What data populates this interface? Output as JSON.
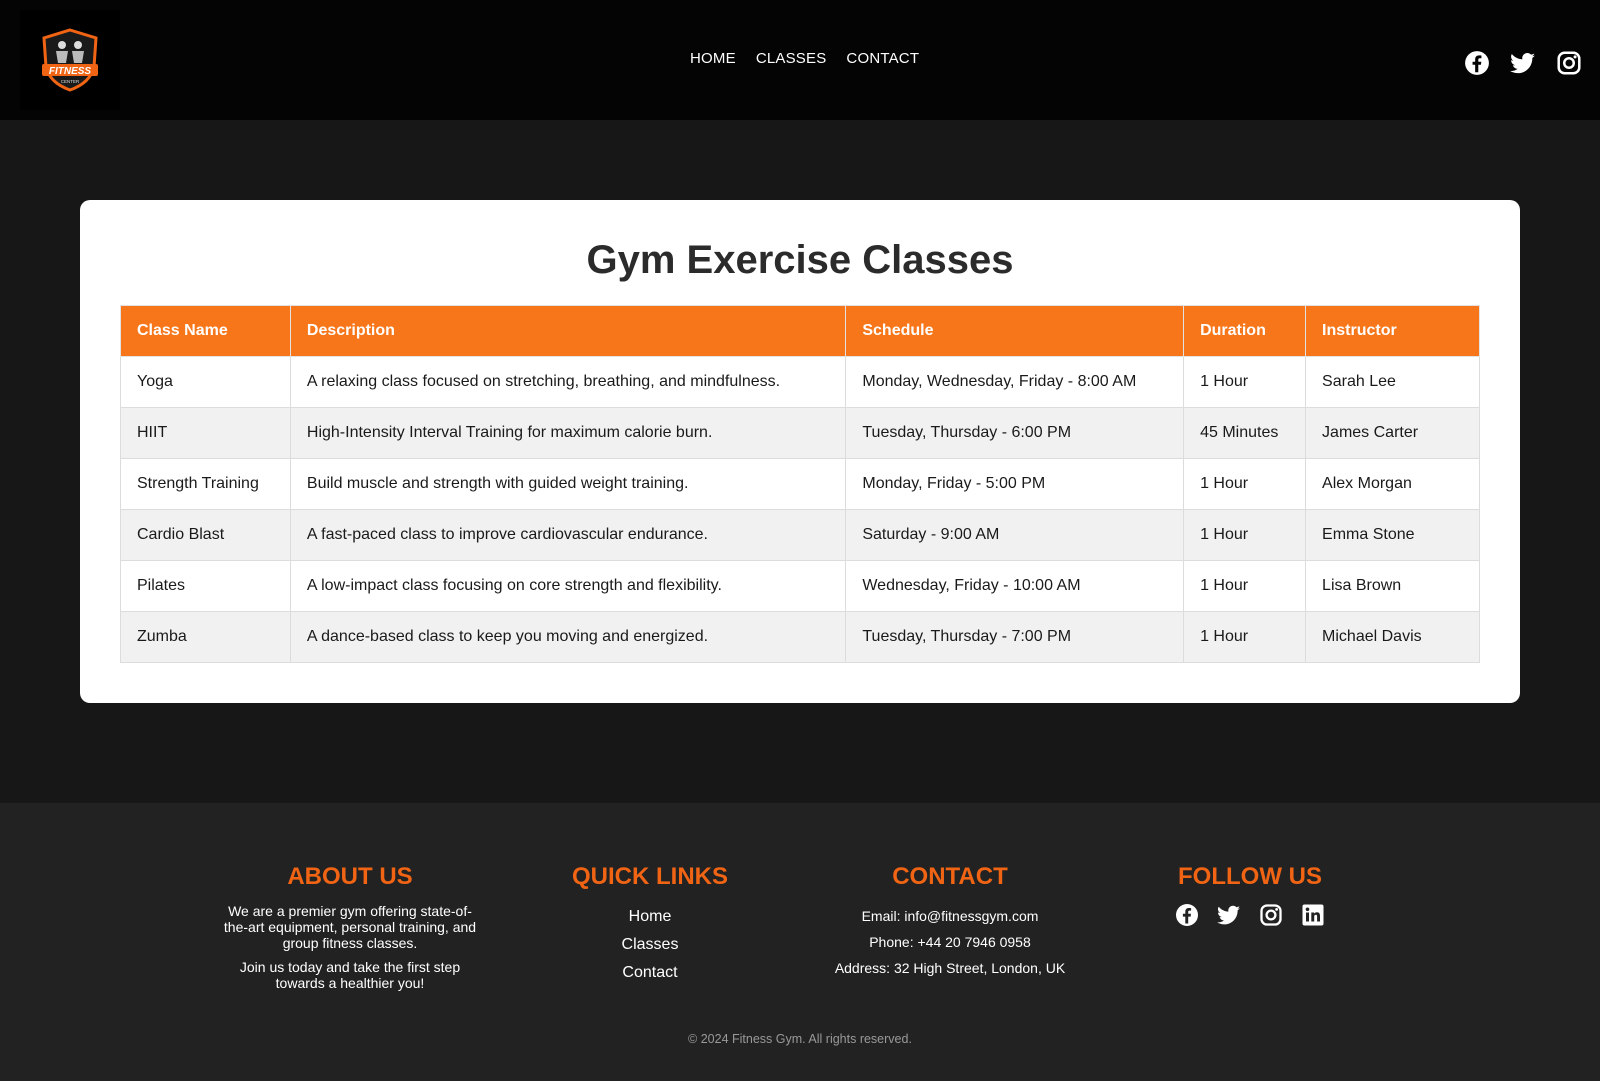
{
  "header": {
    "logo": {
      "text_main": "FITNESS",
      "text_sub": "CENTER"
    },
    "nav": [
      {
        "label": "HOME"
      },
      {
        "label": "CLASSES"
      },
      {
        "label": "CONTACT"
      }
    ],
    "social": [
      "facebook-icon",
      "twitter-icon",
      "instagram-icon"
    ]
  },
  "main": {
    "title": "Gym Exercise Classes",
    "table": {
      "headers": [
        "Class Name",
        "Description",
        "Schedule",
        "Duration",
        "Instructor"
      ],
      "rows": [
        [
          "Yoga",
          "A relaxing class focused on stretching, breathing, and mindfulness.",
          "Monday, Wednesday, Friday - 8:00 AM",
          "1 Hour",
          "Sarah Lee"
        ],
        [
          "HIIT",
          "High-Intensity Interval Training for maximum calorie burn.",
          "Tuesday, Thursday - 6:00 PM",
          "45 Minutes",
          "James Carter"
        ],
        [
          "Strength Training",
          "Build muscle and strength with guided weight training.",
          "Monday, Friday - 5:00 PM",
          "1 Hour",
          "Alex Morgan"
        ],
        [
          "Cardio Blast",
          "A fast-paced class to improve cardiovascular endurance.",
          "Saturday - 9:00 AM",
          "1 Hour",
          "Emma Stone"
        ],
        [
          "Pilates",
          "A low-impact class focusing on core strength and flexibility.",
          "Wednesday, Friday - 10:00 AM",
          "1 Hour",
          "Lisa Brown"
        ],
        [
          "Zumba",
          "A dance-based class to keep you moving and energized.",
          "Tuesday, Thursday - 7:00 PM",
          "1 Hour",
          "Michael Davis"
        ]
      ]
    }
  },
  "footer": {
    "about": {
      "title": "ABOUT US",
      "p1": "We are a premier gym offering state-of-the-art equipment, personal training, and group fitness classes.",
      "p2": "Join us today and take the first step towards a healthier you!"
    },
    "quick_links": {
      "title": "QUICK LINKS",
      "items": [
        {
          "label": "Home"
        },
        {
          "label": "Classes"
        },
        {
          "label": "Contact"
        }
      ]
    },
    "contact": {
      "title": "CONTACT",
      "email": "Email: info@fitnessgym.com",
      "phone": "Phone: +44 20 7946 0958",
      "address": "Address: 32 High Street, London, UK"
    },
    "follow": {
      "title": "FOLLOW US",
      "icons": [
        "facebook-icon",
        "twitter-icon",
        "instagram-icon",
        "linkedin-icon"
      ]
    },
    "copyright": "© 2024 Fitness Gym. All rights reserved."
  },
  "colors": {
    "accent": "#f8761a",
    "footer_heading": "#f06414",
    "header_bg": "#040404",
    "page_bg": "#171717",
    "footer_bg": "#222222"
  }
}
